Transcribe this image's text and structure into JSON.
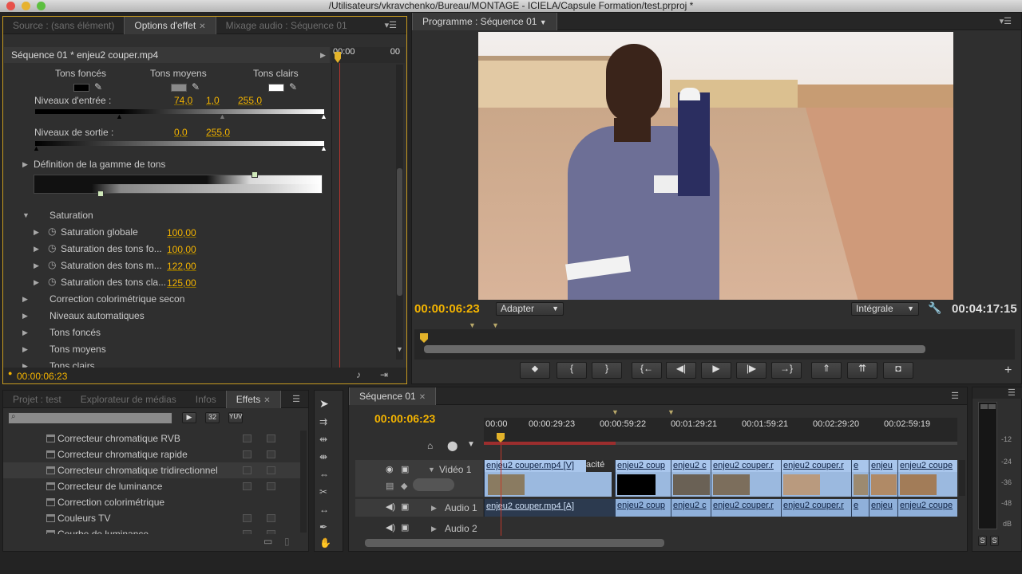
{
  "window": {
    "title": "/Utilisateurs/vkravchenko/Bureau/MONTAGE - ICIELA/Capsule Formation/test.prproj *"
  },
  "source_panel": {
    "tabs": [
      {
        "label": "Source : (sans élément)"
      },
      {
        "label": "Options d'effet"
      },
      {
        "label": "Mixage audio : Séquence 01"
      }
    ],
    "clip_header": "Séquence 01 * enjeu2 couper.mp4",
    "timecode_start": "00:00",
    "timecode_end": "00",
    "tones": {
      "dark": "Tons foncés",
      "mid": "Tons moyens",
      "light": "Tons clairs"
    },
    "input_levels": {
      "label": "Niveaux d'entrée :",
      "v1": "74,0",
      "v2": "1,0",
      "v3": "255,0"
    },
    "output_levels": {
      "label": "Niveaux de sortie :",
      "v1": "0,0",
      "v2": "255,0"
    },
    "tonal_range": "Définition de la gamme de tons",
    "saturation": {
      "label": "Saturation",
      "items": [
        {
          "label": "Saturation globale",
          "value": "100,00"
        },
        {
          "label": "Saturation des tons fo...",
          "value": "100,00"
        },
        {
          "label": "Saturation des tons m...",
          "value": "122,00"
        },
        {
          "label": "Saturation des tons cla...",
          "value": "125,00"
        }
      ]
    },
    "sections": [
      "Correction colorimétrique secon",
      "Niveaux automatiques",
      "Tons foncés",
      "Tons moyens",
      "Tons clairs"
    ],
    "footer_timecode": "00:00:06:23"
  },
  "program_panel": {
    "tab": "Programme : Séquence 01",
    "timecode": "00:00:06:23",
    "fit": "Adapter",
    "quality": "Intégrale",
    "duration": "00:04:17:15"
  },
  "project_panel": {
    "tabs": [
      {
        "label": "Projet : test"
      },
      {
        "label": "Explorateur de médias"
      },
      {
        "label": "Infos"
      },
      {
        "label": "Effets"
      }
    ],
    "badges": [
      "32",
      "YUV"
    ],
    "items": [
      {
        "label": "Correcteur chromatique RVB"
      },
      {
        "label": "Correcteur chromatique rapide"
      },
      {
        "label": "Correcteur chromatique tridirectionnel"
      },
      {
        "label": "Correcteur de luminance"
      },
      {
        "label": "Correction colorimétrique"
      },
      {
        "label": "Couleurs TV"
      },
      {
        "label": "Courbe de luminance"
      }
    ]
  },
  "timeline": {
    "tab": "Séquence 01",
    "timecode": "00:00:06:23",
    "ruler": [
      "00:00",
      "00:00:29:23",
      "00:00:59:22",
      "00:01:29:21",
      "00:01:59:21",
      "00:02:29:20",
      "00:02:59:19"
    ],
    "tracks": {
      "video1": "Vidéo 1",
      "audio1": "Audio 1",
      "audio2": "Audio 2"
    },
    "video_clips": [
      {
        "name": "enjeu2 couper.mp4 [V]"
      },
      {
        "name": "acité"
      },
      {
        "name": "enjeu2 coup"
      },
      {
        "name": "enjeu2 c"
      },
      {
        "name": "enjeu2 couper.r"
      },
      {
        "name": "enjeu2 couper.r"
      },
      {
        "name": "e"
      },
      {
        "name": "enjeu"
      },
      {
        "name": "enjeu2 coupe"
      }
    ],
    "audio_clips": [
      {
        "name": "enjeu2 couper.mp4 [A]"
      },
      {
        "name": "enjeu2 coup"
      },
      {
        "name": "enjeu2 c"
      },
      {
        "name": "enjeu2 couper.r"
      },
      {
        "name": "enjeu2 couper.r"
      },
      {
        "name": "e"
      },
      {
        "name": "enjeu"
      },
      {
        "name": "enjeu2 coupe"
      }
    ]
  },
  "audio_meter": {
    "scale": [
      "-12",
      "-24",
      "-36",
      "-48",
      "dB"
    ],
    "solo": [
      "S",
      "S"
    ]
  }
}
